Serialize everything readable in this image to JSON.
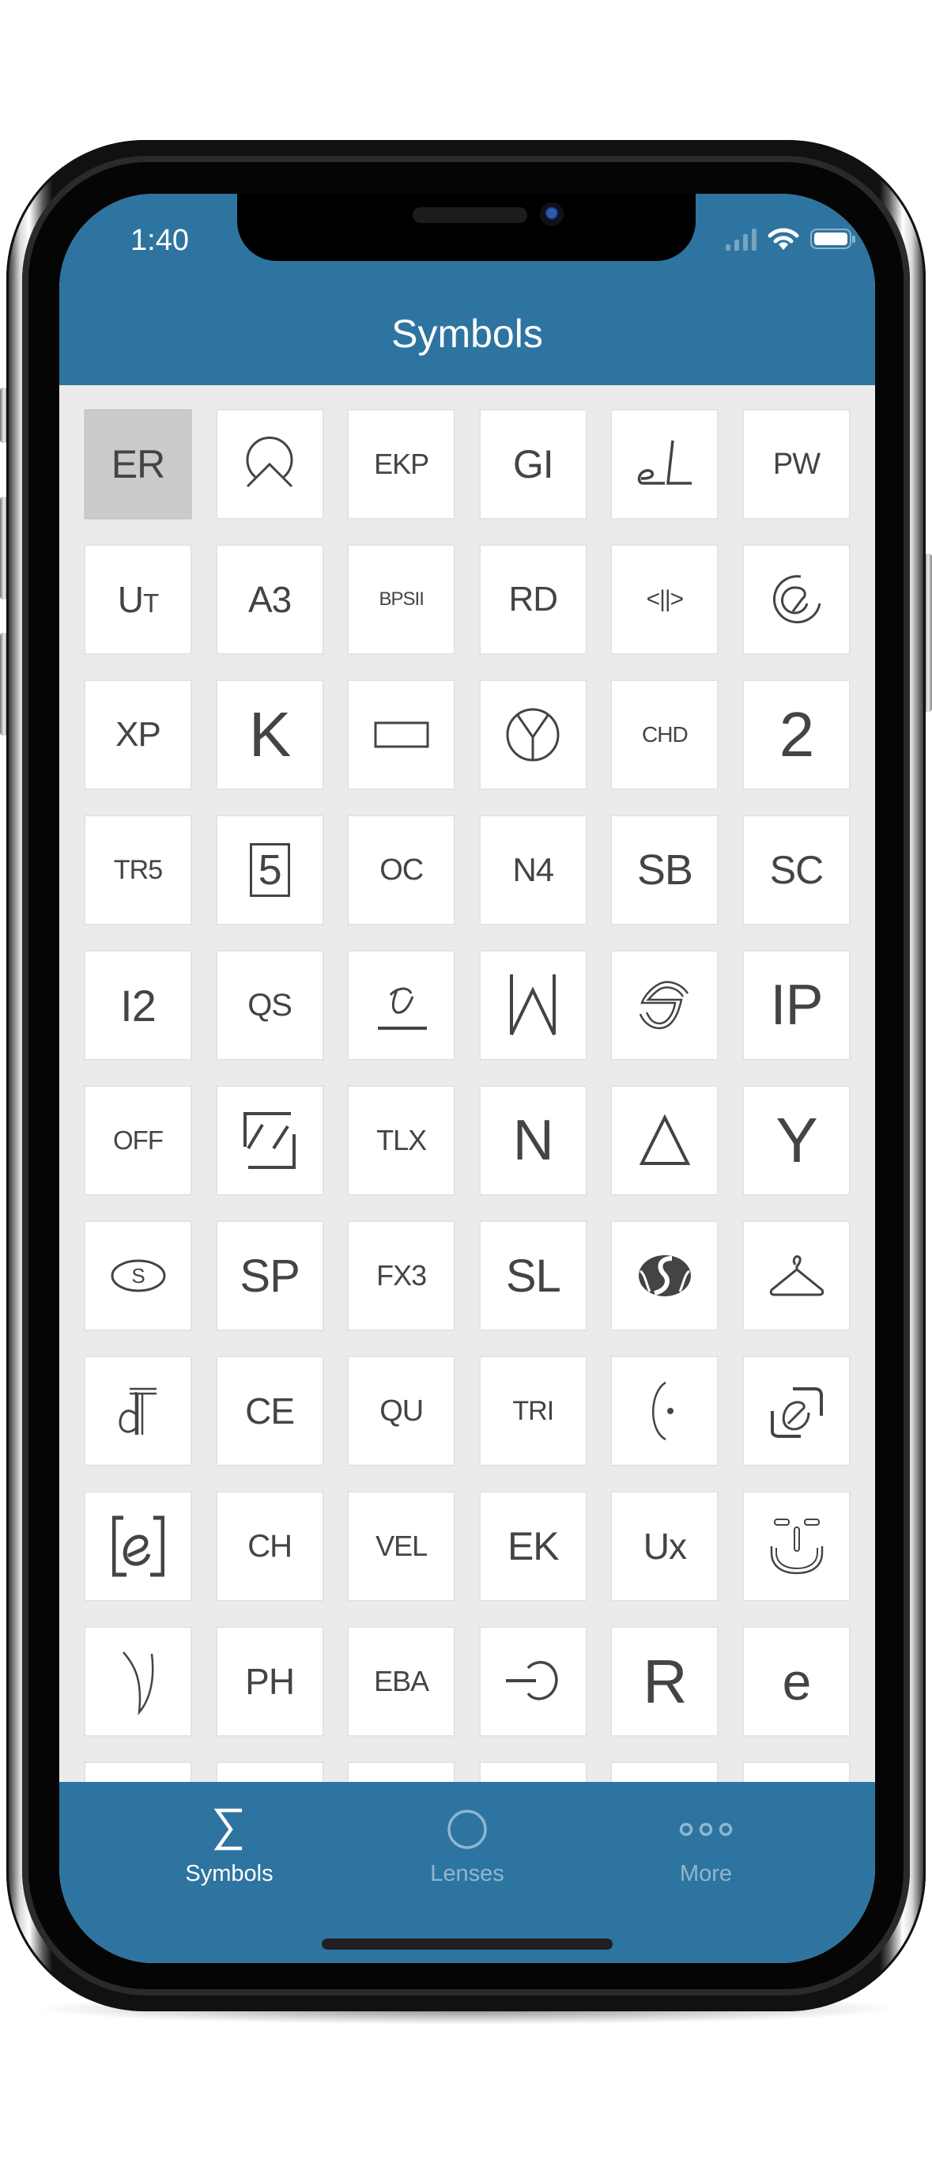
{
  "status_bar": {
    "time": "1:40",
    "signal_icon": "cellular-signal-icon",
    "wifi_icon": "wifi-icon",
    "battery_icon": "battery-icon",
    "battery_level": 1.0
  },
  "header": {
    "title": "Symbols"
  },
  "colors": {
    "brand": "#2E74A0",
    "grid_background": "#EBEBEB",
    "tile": "#FFFFFF",
    "tile_selected": "#CBCBCB",
    "glyph": "#444444",
    "tab_active": "#FFFFFF",
    "tab_inactive": "#8FB6D0"
  },
  "symbols": [
    {
      "label": "ER",
      "selected": true
    },
    {
      "icon": "circle-chevron-symbol-icon"
    },
    {
      "label": "EKP"
    },
    {
      "label": "GI"
    },
    {
      "icon": "script-el-symbol-icon"
    },
    {
      "label": "PW"
    },
    {
      "label": "UT"
    },
    {
      "label": "A3"
    },
    {
      "label": "BPSII"
    },
    {
      "label": "RD"
    },
    {
      "label": "<||>"
    },
    {
      "icon": "spiral-e-symbol-icon"
    },
    {
      "label": "XP"
    },
    {
      "label": "K"
    },
    {
      "icon": "rectangle-symbol-icon"
    },
    {
      "icon": "circle-y-symbol-icon"
    },
    {
      "label": "CHD"
    },
    {
      "label": "2"
    },
    {
      "label": "TR5"
    },
    {
      "label": "5",
      "boxed": true
    },
    {
      "label": "OC"
    },
    {
      "label": "N4"
    },
    {
      "label": "SB"
    },
    {
      "label": "SC"
    },
    {
      "label": "I2"
    },
    {
      "label": "QS"
    },
    {
      "icon": "underlined-e-symbol-icon"
    },
    {
      "icon": "w-symbol-icon"
    },
    {
      "icon": "outlined-s-symbol-icon"
    },
    {
      "label": "IP"
    },
    {
      "label": "OFF"
    },
    {
      "icon": "bracket-slashes-symbol-icon"
    },
    {
      "label": "TLX"
    },
    {
      "label": "N"
    },
    {
      "icon": "triangle-symbol-icon"
    },
    {
      "label": "Y"
    },
    {
      "icon": "oval-s-symbol-icon"
    },
    {
      "label": "SP"
    },
    {
      "label": "FX3"
    },
    {
      "label": "SL"
    },
    {
      "icon": "filled-circle-s-symbol-icon"
    },
    {
      "icon": "hanger-symbol-icon"
    },
    {
      "icon": "d-t-symbol-icon"
    },
    {
      "label": "CE"
    },
    {
      "label": "QU"
    },
    {
      "label": "TRI"
    },
    {
      "icon": "paren-dot-symbol-icon"
    },
    {
      "icon": "hook-e-symbol-icon"
    },
    {
      "icon": "bracket-e-symbol-icon"
    },
    {
      "label": "CH"
    },
    {
      "label": "VEL"
    },
    {
      "label": "EK"
    },
    {
      "label": "Ux"
    },
    {
      "icon": "smiley-symbol-icon"
    },
    {
      "icon": "crescent-symbol-icon"
    },
    {
      "label": "PH"
    },
    {
      "label": "EBA"
    },
    {
      "icon": "arrow-arc-symbol-icon"
    },
    {
      "label": "R"
    },
    {
      "label": "e"
    }
  ],
  "tabs": [
    {
      "label": "Symbols",
      "icon": "sigma-icon",
      "active": true
    },
    {
      "label": "Lenses",
      "icon": "circle-icon",
      "active": false
    },
    {
      "label": "More",
      "icon": "more-dots-icon",
      "active": false
    }
  ]
}
